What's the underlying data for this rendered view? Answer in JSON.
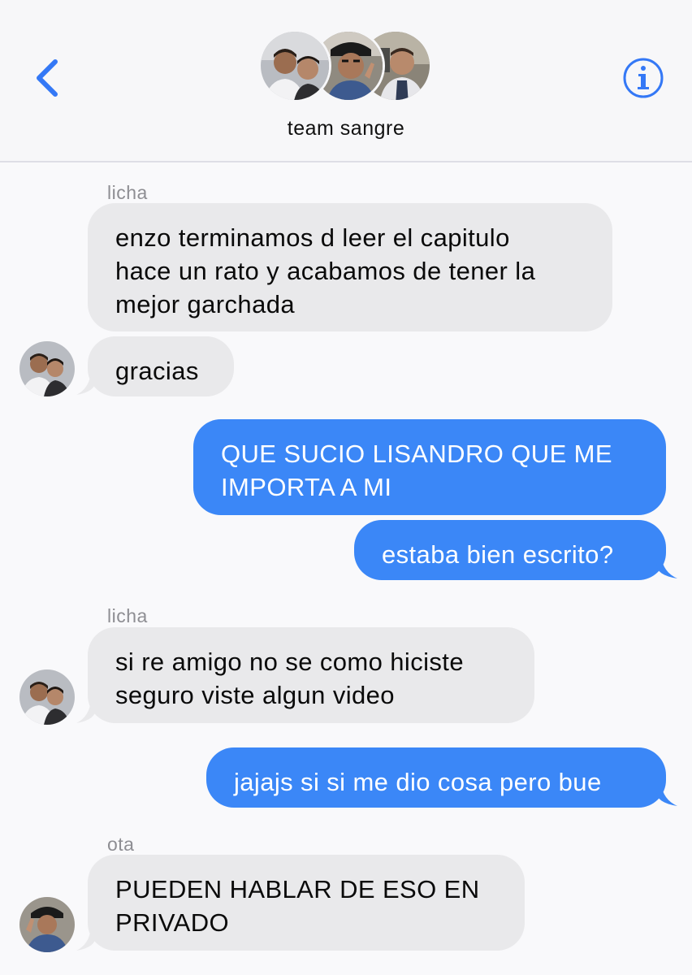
{
  "header": {
    "group_name": "team sangre",
    "back_icon": "chevron-left-icon",
    "info_icon": "info-circle-icon",
    "accent": "#3478f6"
  },
  "colors": {
    "incoming_bubble": "#e9e9eb",
    "outgoing_bubble": "#3b87f7",
    "sender_label": "#8e8e93"
  },
  "messages": [
    {
      "sender": "licha",
      "direction": "in",
      "lines": [
        "enzo terminamos d leer el capitulo",
        "hace un rato y acabamos de tener la",
        "mejor garchada"
      ]
    },
    {
      "direction": "in",
      "lines": [
        "gracias"
      ]
    },
    {
      "direction": "out",
      "lines": [
        "QUE SUCIO LISANDRO QUE ME",
        "IMPORTA A MI"
      ]
    },
    {
      "direction": "out",
      "lines": [
        "estaba bien escrito?"
      ]
    },
    {
      "sender": "licha",
      "direction": "in",
      "lines": [
        "si re amigo no se como hiciste",
        "seguro viste algun video"
      ]
    },
    {
      "direction": "out",
      "lines": [
        "jajajs si si me dio cosa pero bue"
      ]
    },
    {
      "sender": "ota",
      "direction": "in",
      "lines": [
        "PUEDEN HABLAR DE ESO EN",
        "PRIVADO"
      ]
    }
  ]
}
